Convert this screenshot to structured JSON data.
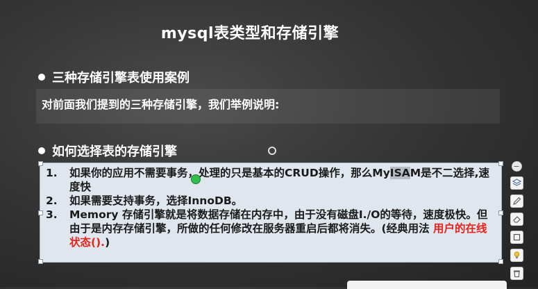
{
  "slide": {
    "title": "mysql表类型和存储引擎",
    "section1": {
      "heading": "三种存储引擎表使用案例",
      "description": "对前面我们提到的三种存储引擎，我们举例说明:"
    },
    "section2": {
      "heading": "如何选择表的存储引擎",
      "items": [
        {
          "num": "1.",
          "text_a": "如果你的应用不需要事务，处理的只是基本的CRUD操作，那么My",
          "text_b": "ISA",
          "text_c": "M是不二选择,速度快"
        },
        {
          "num": "2.",
          "text": "如果需要支持事务，选择InnoDB。"
        },
        {
          "num": "3.",
          "text_a": "Memory 存储引擎就是将数据存储在内存中，由于没有磁盘I./O的等待，速度极快。但由于是内存存储引擎，所做的任何修改在服务器重启后都将消失。(经典用法 ",
          "text_red": "用户的在线状态().",
          "text_c": ")"
        }
      ]
    }
  },
  "toolbar": {
    "icons": [
      "minus-icon",
      "layers-icon",
      "pen-icon",
      "eraser-icon",
      "square-icon",
      "bulb-icon",
      "trash-icon"
    ]
  },
  "colors": {
    "background": "#353535",
    "list_box": "#dfe6ed",
    "accent_red": "#e8231b",
    "pointer_green": "#2fbf4a"
  }
}
